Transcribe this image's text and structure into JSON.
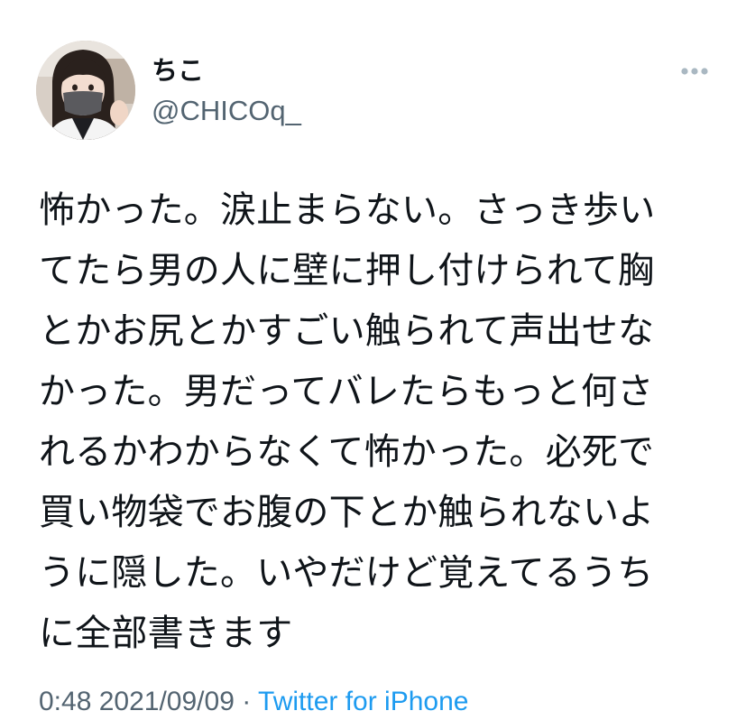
{
  "tweet": {
    "author": {
      "display_name": "ちこ",
      "handle": "@CHICOq_",
      "avatar_icon": "profile-photo"
    },
    "more_icon": "more-horizontal-icon",
    "text_lines": [
      "怖かった。涙止まらない。さっき歩い",
      "てたら男の人に壁に押し付けられて胸",
      "とかお尻とかすごい触られて声出せな",
      "かった。男だってバレたらもっと何さ",
      "れるかわからなくて怖かった。必死で",
      "買い物袋でお腹の下とか触られないよ",
      "うに隠した。いやだけど覚えてるうち",
      "に全部書きます"
    ],
    "time": "0:48",
    "date": "2021/09/09",
    "separator": "·",
    "source": "Twitter for iPhone"
  },
  "colors": {
    "text": "#0f1419",
    "secondary": "#536471",
    "link": "#1d9bf0",
    "dots": "#aab8c2"
  }
}
